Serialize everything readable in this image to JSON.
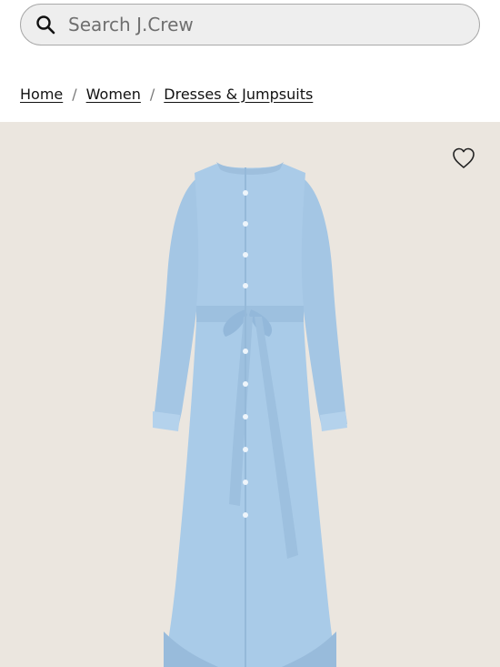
{
  "search": {
    "placeholder": "Search J.Crew",
    "icon": "search-icon"
  },
  "breadcrumb": {
    "items": [
      "Home",
      "Women",
      "Dresses & Jumpsuits"
    ],
    "separator": "/"
  },
  "product": {
    "image_alt_name": "light blue belted button-front maxi dress",
    "background_color": "#ebe6df",
    "dress_color": "#a9cbe8",
    "wishlist_icon": "heart-outline-icon"
  }
}
